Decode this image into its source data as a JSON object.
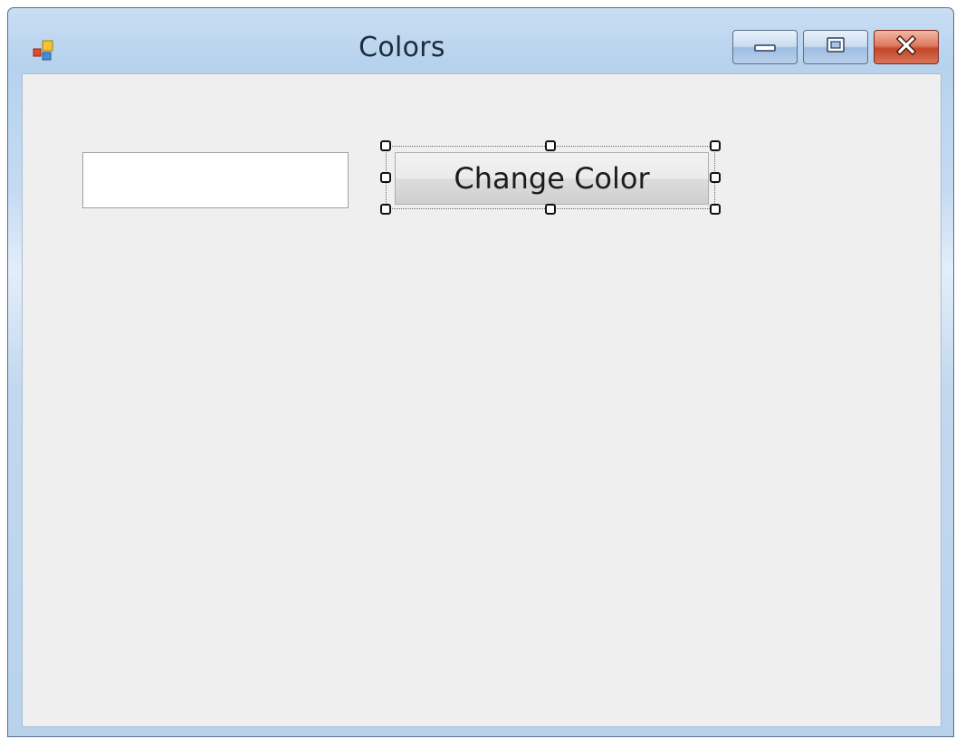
{
  "window": {
    "title": "Colors",
    "controls": {
      "minimize_icon": "minimize-icon",
      "maximize_icon": "maximize-icon",
      "close_icon": "close-icon"
    }
  },
  "form": {
    "textbox": {
      "value": "",
      "placeholder": ""
    },
    "button": {
      "label": "Change Color",
      "selected_in_designer": true
    }
  },
  "colors": {
    "client_background": "#efefef",
    "close_button": "#c3472a",
    "titlebar": "#b7d2ee"
  }
}
